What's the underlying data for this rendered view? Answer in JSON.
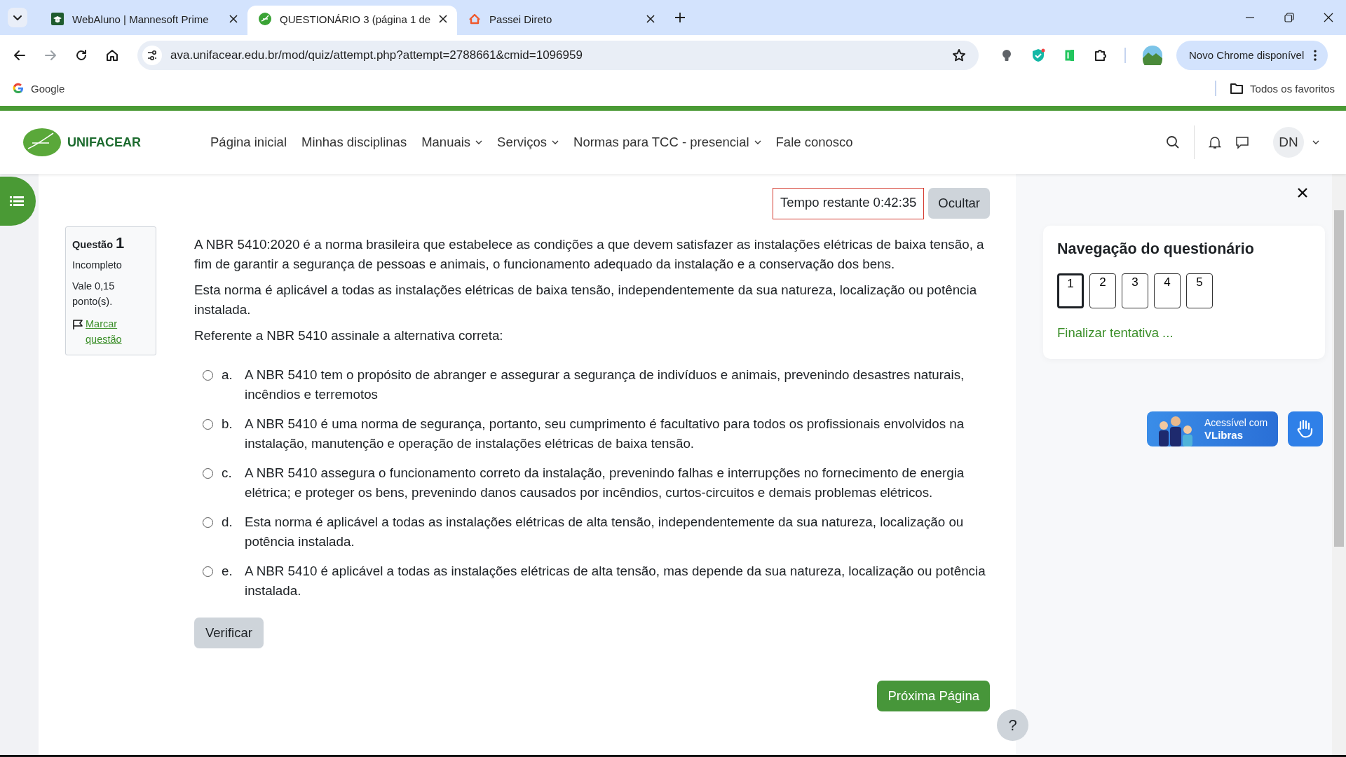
{
  "browser": {
    "tabs": [
      {
        "title": "WebAluno | Mannesoft Prime",
        "selected": false
      },
      {
        "title": "QUESTIONÁRIO 3 (página 1 de",
        "selected": true
      },
      {
        "title": "Passei Direto",
        "selected": false
      }
    ],
    "url": "ava.unifacear.edu.br/mod/quiz/attempt.php?attempt=2788661&cmid=1096959",
    "update_button": "Novo Chrome disponível",
    "bookmarks": [
      {
        "label": "Google"
      }
    ],
    "all_bookmarks": "Todos os favoritos"
  },
  "site": {
    "logo": "UNIFACEAR",
    "nav": [
      {
        "label": "Página inicial",
        "kind": "link"
      },
      {
        "label": "Minhas disciplinas",
        "kind": "link"
      },
      {
        "label": "Manuais",
        "kind": "dropdown"
      },
      {
        "label": "Serviços",
        "kind": "dropdown"
      },
      {
        "label": "Normas para TCC - presencial",
        "kind": "dropdown"
      },
      {
        "label": "Fale conosco",
        "kind": "link"
      }
    ],
    "user_initials": "DN"
  },
  "timer": {
    "text": "Tempo restante 0:42:35",
    "hide_button": "Ocultar"
  },
  "question_info": {
    "label": "Questão",
    "number": "1",
    "state": "Incompleto",
    "grade": "Vale 0,15 ponto(s).",
    "flag_link": "Marcar questão"
  },
  "question": {
    "paragraphs": [
      "A NBR 5410:2020 é a norma brasileira que estabelece as condições a que devem satisfazer as instalações elétricas de baixa tensão, a fim de garantir a segurança de pessoas e animais, o funcionamento adequado da instalação e a conservação dos bens.",
      "Esta norma é aplicável a todas as instalações elétricas de baixa tensão, independentemente da sua natureza, localização ou potência instalada.",
      "Referente a NBR 5410 assinale a alternativa correta:"
    ],
    "options": [
      {
        "letter": "a.",
        "text": " A NBR 5410 tem o propósito de abranger e assegurar a segurança de indivíduos e animais, prevenindo desastres naturais, incêndios e terremotos",
        "selected": false
      },
      {
        "letter": "b.",
        "text": "A NBR 5410 é uma norma de segurança, portanto, seu cumprimento é facultativo para todos os profissionais envolvidos na instalação, manutenção e operação de instalações elétricas de baixa tensão.",
        "selected": false
      },
      {
        "letter": "c.",
        "text": "A NBR 5410 assegura o funcionamento correto da instalação, prevenindo falhas e interrupções no fornecimento de energia elétrica; e proteger os bens, prevenindo danos causados por incêndios, curtos-circuitos e demais problemas elétricos.",
        "selected": false
      },
      {
        "letter": "d.",
        "text": "Esta norma é aplicável a todas as instalações elétricas de alta tensão, independentemente da sua natureza, localização ou potência instalada.",
        "selected": false
      },
      {
        "letter": "e.",
        "text": "A NBR 5410 é aplicável a todas as instalações elétricas de alta tensão, mas depende da sua natureza, localização ou potência instalada.",
        "selected": false
      }
    ],
    "check_button": "Verificar"
  },
  "next_button": "Próxima Página",
  "help_button": "?",
  "quiz_nav": {
    "title": "Navegação do questionário",
    "questions": [
      {
        "label": "1",
        "selected": true
      },
      {
        "label": "2",
        "selected": false
      },
      {
        "label": "3",
        "selected": false
      },
      {
        "label": "4",
        "selected": false
      },
      {
        "label": "5",
        "selected": false
      }
    ],
    "finish_link": "Finalizar tentativa ..."
  },
  "vlibras": {
    "line1": "Acessível com",
    "line2": "VLibras"
  }
}
